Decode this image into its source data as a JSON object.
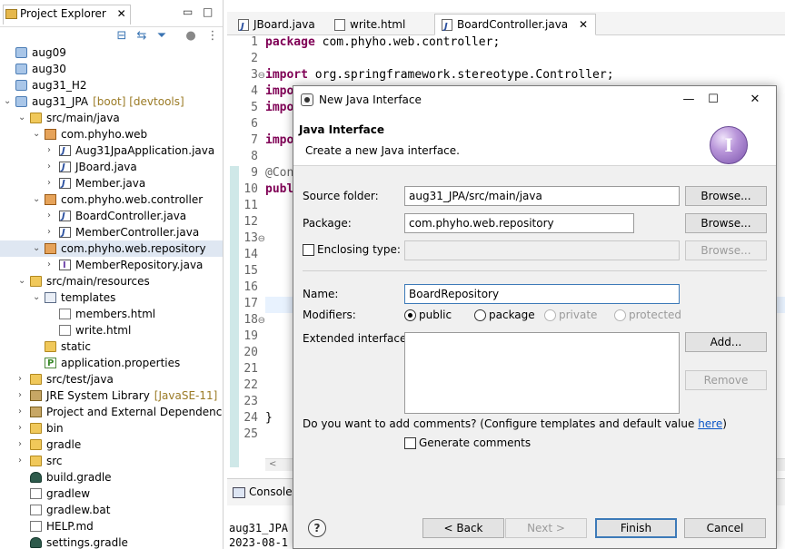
{
  "explorer": {
    "title": "Project Explorer",
    "close": "✕",
    "minimize": "▭",
    "maximize": "□",
    "tree": [
      {
        "label": "aug09",
        "icon": "project-icon",
        "indent": 0,
        "arrow": ""
      },
      {
        "label": "aug30",
        "icon": "project-icon",
        "indent": 0,
        "arrow": ""
      },
      {
        "label": "aug31_H2",
        "icon": "project-icon",
        "indent": 0,
        "arrow": ""
      },
      {
        "label": "aug31_JPA",
        "decoration": "[boot] [devtools]",
        "icon": "project-icon",
        "indent": 0,
        "arrow": "⌄"
      },
      {
        "label": "src/main/java",
        "icon": "folder-icon",
        "indent": 1,
        "arrow": "⌄"
      },
      {
        "label": "com.phyho.web",
        "icon": "package-icon",
        "indent": 2,
        "arrow": "⌄"
      },
      {
        "label": "Aug31JpaApplication.java",
        "icon": "java-file-icon",
        "indent": 3,
        "arrow": "›"
      },
      {
        "label": "JBoard.java",
        "icon": "java-file-icon",
        "indent": 3,
        "arrow": "›"
      },
      {
        "label": "Member.java",
        "icon": "java-file-icon",
        "indent": 3,
        "arrow": "›"
      },
      {
        "label": "com.phyho.web.controller",
        "icon": "package-icon",
        "indent": 2,
        "arrow": "⌄"
      },
      {
        "label": "BoardController.java",
        "icon": "java-file-icon",
        "indent": 3,
        "arrow": "›"
      },
      {
        "label": "MemberController.java",
        "icon": "java-file-icon",
        "indent": 3,
        "arrow": "›"
      },
      {
        "label": "com.phyho.web.repository",
        "icon": "package-icon",
        "indent": 2,
        "arrow": "⌄",
        "selected": true
      },
      {
        "label": "MemberRepository.java",
        "icon": "interface-file-icon",
        "indent": 3,
        "arrow": "›"
      },
      {
        "label": "src/main/resources",
        "icon": "folder-icon",
        "indent": 1,
        "arrow": "⌄"
      },
      {
        "label": "templates",
        "icon": "templates-folder-icon",
        "indent": 2,
        "arrow": "⌄"
      },
      {
        "label": "members.html",
        "icon": "file-icon",
        "indent": 3,
        "arrow": ""
      },
      {
        "label": "write.html",
        "icon": "file-icon",
        "indent": 3,
        "arrow": ""
      },
      {
        "label": "static",
        "icon": "folder-icon",
        "indent": 2,
        "arrow": ""
      },
      {
        "label": "application.properties",
        "icon": "properties-file-icon",
        "indent": 2,
        "arrow": ""
      },
      {
        "label": "src/test/java",
        "icon": "folder-icon",
        "indent": 1,
        "arrow": "›"
      },
      {
        "label": "JRE System Library",
        "decoration": "[JavaSE-11]",
        "icon": "library-icon",
        "indent": 1,
        "arrow": "›"
      },
      {
        "label": "Project and External Dependencies",
        "icon": "library-icon",
        "indent": 1,
        "arrow": "›"
      },
      {
        "label": "bin",
        "icon": "folder-icon",
        "indent": 1,
        "arrow": "›"
      },
      {
        "label": "gradle",
        "icon": "folder-icon",
        "indent": 1,
        "arrow": "›"
      },
      {
        "label": "src",
        "icon": "folder-icon",
        "indent": 1,
        "arrow": "›"
      },
      {
        "label": "build.gradle",
        "icon": "gradle-icon",
        "indent": 1,
        "arrow": ""
      },
      {
        "label": "gradlew",
        "icon": "file-icon",
        "indent": 1,
        "arrow": ""
      },
      {
        "label": "gradlew.bat",
        "icon": "file-icon",
        "indent": 1,
        "arrow": ""
      },
      {
        "label": "HELP.md",
        "icon": "file-icon",
        "indent": 1,
        "arrow": ""
      },
      {
        "label": "settings.gradle",
        "icon": "gradle-icon",
        "indent": 1,
        "arrow": ""
      }
    ]
  },
  "editor": {
    "tabs": [
      {
        "label": "JBoard.java",
        "active": false
      },
      {
        "label": "write.html",
        "active": false
      },
      {
        "label": "BoardController.java",
        "active": true
      }
    ],
    "tab_close": "✕",
    "line_numbers": [
      "1",
      "2",
      "3",
      "4",
      "5",
      "6",
      "7",
      "8",
      "9",
      "10",
      "11",
      "12",
      "13",
      "14",
      "15",
      "16",
      "17",
      "18",
      "19",
      "20",
      "21",
      "22",
      "23",
      "24",
      "25"
    ],
    "code": {
      "l1_kw": "package",
      "l1_rest": " com.phyho.web.controller;",
      "l3_kw": "import",
      "l3_rest": " org.springframework.stereotype.Controller;",
      "l4_kw": "impo",
      "l5_kw": "impo",
      "l7_kw": "impo",
      "l9_ann": "@Con",
      "l10_kw": "publ",
      "l24": "}"
    },
    "console_tab": "Console",
    "console_line1": "aug31_JPA -",
    "console_line2": "2023-08-1",
    "scroll_left": "<"
  },
  "dialog": {
    "title": "New Java Interface",
    "minimize": "—",
    "maximize": "☐",
    "close": "✕",
    "header_title": "Java Interface",
    "header_desc": "Create a new Java interface.",
    "header_icon_letter": "I",
    "source_folder_label": "Source folder:",
    "source_folder_value": "aug31_JPA/src/main/java",
    "package_label": "Package:",
    "package_value": "com.phyho.web.repository",
    "enclosing_label": "Enclosing type:",
    "enclosing_value": "",
    "browse_label": "Browse...",
    "name_label": "Name:",
    "name_value": "BoardRepository",
    "modifiers_label": "Modifiers:",
    "modifiers": {
      "public": "public",
      "package": "package",
      "private": "private",
      "protected": "protected"
    },
    "extended_label": "Extended interfaces:",
    "add_label": "Add...",
    "remove_label": "Remove",
    "comments_prompt": "Do you want to add comments? (Configure templates and default value ",
    "comments_link": "here",
    "comments_close": ")",
    "generate_comments_label": "Generate comments",
    "help_label": "?",
    "back_label": "< Back",
    "next_label": "Next >",
    "finish_label": "Finish",
    "cancel_label": "Cancel"
  }
}
